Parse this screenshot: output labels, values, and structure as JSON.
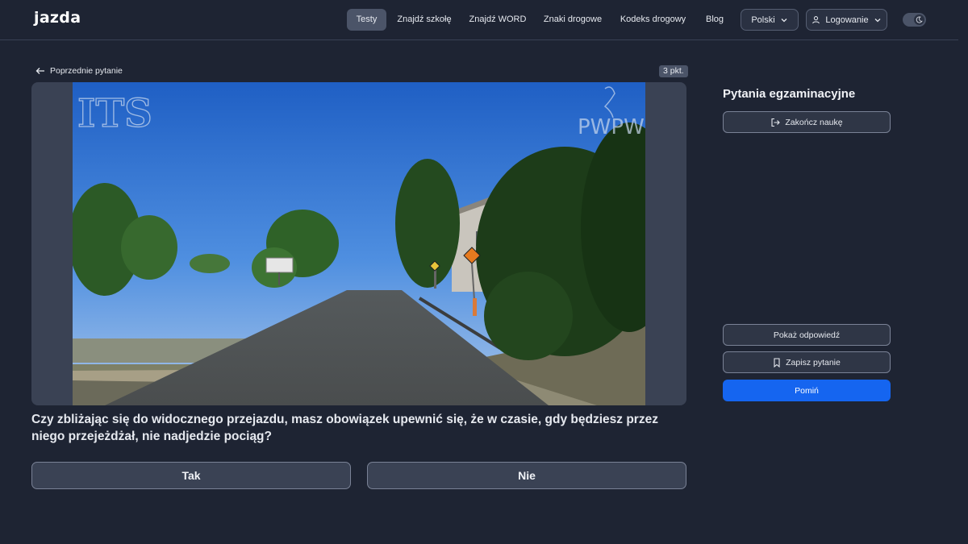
{
  "header": {
    "logo": "jazda",
    "nav": [
      {
        "label": "Testy",
        "active": true
      },
      {
        "label": "Znajdź szkołę",
        "active": false
      },
      {
        "label": "Znajdź WORD",
        "active": false
      },
      {
        "label": "Znaki drogowe",
        "active": false
      },
      {
        "label": "Kodeks drogowy",
        "active": false
      },
      {
        "label": "Blog",
        "active": false
      }
    ],
    "language": "Polski",
    "login": "Logowanie",
    "theme_toggle_icon": "moon-icon"
  },
  "question": {
    "back_label": "Poprzednie pytanie",
    "points": "3 pkt.",
    "watermark_left": "ITS",
    "watermark_right": "PWPW",
    "text": "Czy zbliżając się do widocznego przejazdu, masz obowiązek upewnić się, że w czasie, gdy będziesz przez niego przejeżdżał, nie nadjedzie pociąg?",
    "answers": [
      "Tak",
      "Nie"
    ]
  },
  "sidebar": {
    "title": "Pytania egzaminacyjne",
    "finish_label": "Zakończ naukę",
    "show_answer_label": "Pokaż odpowiedź",
    "save_label": "Zapisz pytanie",
    "skip_label": "Pomiń"
  },
  "colors": {
    "background": "#1e2433",
    "primary": "#1565f0",
    "surface": "#3a4254"
  }
}
